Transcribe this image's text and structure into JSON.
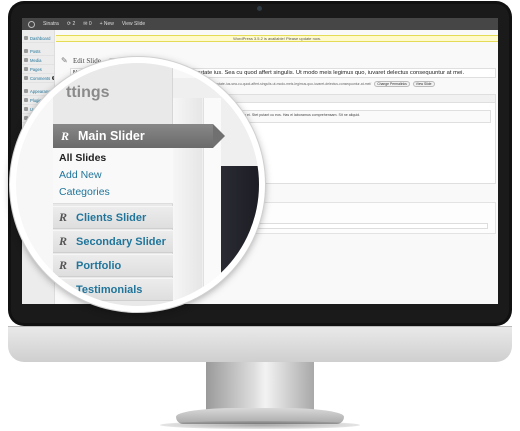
{
  "adminbar": {
    "site": "Sinatra",
    "updates": "2",
    "comments": "0",
    "new_label": "New",
    "view": "View Slide"
  },
  "sidebar": {
    "items": [
      {
        "label": "Dashboard"
      },
      {
        "label": "Posts"
      },
      {
        "label": "Media"
      },
      {
        "label": "Pages"
      },
      {
        "label": "Comments",
        "badge": "0"
      },
      {
        "label": "Appearance"
      },
      {
        "label": "Plugins",
        "badge": "1"
      },
      {
        "label": "Users"
      },
      {
        "label": "Tools"
      },
      {
        "label": "Settings"
      },
      {
        "label": "Main"
      }
    ]
  },
  "notice": {
    "text": "WordPress 3.5.2 is available! Please update now."
  },
  "editor": {
    "title": "Edit Slide",
    "add_new": "Add New",
    "title_value": "Ne populo timeam blandit has. Ei ipsum nihil vulputate ius. Sea cu quod affert singulis. Ut modo meis legimus quo, iuvaret delectus consequuntur at mei.",
    "permalink_label": "Permalink:",
    "permalink_url": "http://localhost/...wordpress/?slides=ne-populo-timeam-blandit-has-ei-ipsum-nihil-vulputate-ius-sea-cu-quod-affert-singulis-ut-modo-meis-legimus-quo-iuvaret-delectus-consequuntur-at-mei/",
    "change_permalinks": "Change Permalinks",
    "view_slide": "View Slide"
  },
  "options_box": {
    "title": "Slide Options",
    "description_label": "Description",
    "description_value": "...a eu. Salutandi verterem id. Usu te tempor, mei ipsum impedit cu ei. Stet putant cu eos. Has ei laboramus comprehensam. Sit ne aliquid."
  },
  "magnifier": {
    "ghost_heading": "ttings",
    "main_slider": "Main Slider",
    "submenu": [
      {
        "label": "All Slides",
        "current": true
      },
      {
        "label": "Add New",
        "current": false
      },
      {
        "label": "Categories",
        "current": false
      }
    ],
    "menu_items": [
      {
        "label": "Clients Slider"
      },
      {
        "label": "Secondary Slider"
      },
      {
        "label": "Portfolio"
      },
      {
        "label": "Testimonials"
      }
    ]
  },
  "colors": {
    "link": "#21759b",
    "adminbar": "#464646",
    "active_menu": "#6d6d6d",
    "notice_bg": "#fffbcc"
  }
}
